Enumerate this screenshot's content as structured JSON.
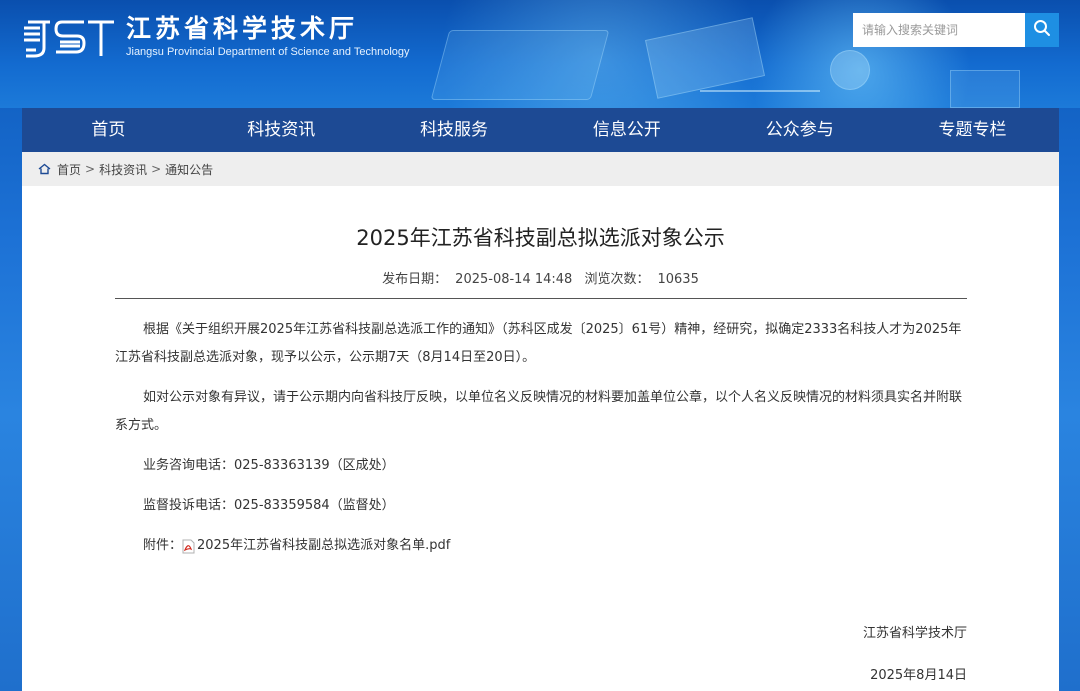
{
  "header": {
    "site_name_cn": "江苏省科学技术厅",
    "site_name_en": "Jiangsu Provincial Department of Science and Technology",
    "logo_mark_text": "JST",
    "search": {
      "placeholder": "请输入搜索关键词",
      "value": "",
      "button_icon": "search-icon"
    }
  },
  "nav": {
    "items": [
      {
        "label": "首页"
      },
      {
        "label": "科技资讯"
      },
      {
        "label": "科技服务"
      },
      {
        "label": "信息公开"
      },
      {
        "label": "公众参与"
      },
      {
        "label": "专题专栏"
      }
    ]
  },
  "breadcrumb": {
    "icon": "home-icon",
    "items": [
      "首页",
      "科技资讯",
      "通知公告"
    ],
    "separator": ">"
  },
  "article": {
    "title": "2025年江苏省科技副总拟选派对象公示",
    "publish_label": "发布日期：",
    "publish_date": "2025-08-14 14:48",
    "views_label": "浏览次数：",
    "views": "10635",
    "paragraphs": [
      "根据《关于组织开展2025年江苏省科技副总选派工作的通知》（苏科区成发〔2025〕61号）精神，经研究，拟确定2333名科技人才为2025年江苏省科技副总选派对象，现予以公示，公示期7天（8月14日至20日）。",
      "如对公示对象有异议，请于公示期内向省科技厅反映，以单位名义反映情况的材料要加盖单位公章，以个人名义反映情况的材料须具实名并附联系方式。"
    ],
    "contact_business": "业务咨询电话：025-83363139（区成处）",
    "contact_supervise": "监督投诉电话：025-83359584（监督处）",
    "attachment_label": "附件：",
    "attachment_name": "2025年江苏省科技副总拟选派对象名单.pdf",
    "attachment_icon": "pdf-icon",
    "signature": "江苏省科学技术厅",
    "sign_date": "2025年8月14日"
  },
  "colors": {
    "nav_bg": "#1d4a94",
    "search_button": "#1e8fe3",
    "breadcrumb_bg": "#eeeeee",
    "hero_blue": "#136bd0"
  }
}
